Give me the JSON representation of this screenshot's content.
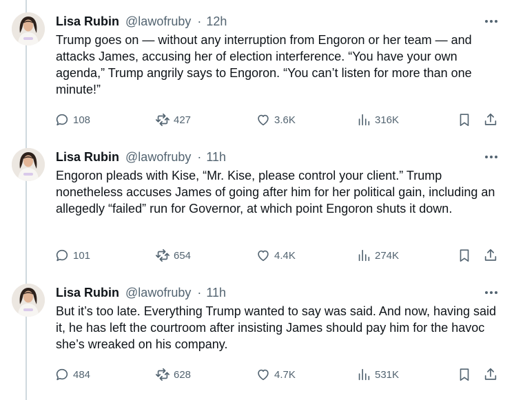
{
  "tweets": [
    {
      "author_name": "Lisa Rubin",
      "handle": "@lawofruby",
      "time": "12h",
      "text": "Trump goes on — without any interruption from Engoron or her team — and attacks James, accusing her of election interference. “You have your own agenda,” Trump angrily says to Engoron. “You can’t listen for more than one minute!”",
      "replies": "108",
      "reposts": "427",
      "likes": "3.6K",
      "views": "316K"
    },
    {
      "author_name": "Lisa Rubin",
      "handle": "@lawofruby",
      "time": "11h",
      "text": "Engoron pleads with Kise, “Mr. Kise, please control your client.” Trump nonetheless accuses James of going after him for her political gain, including an allegedly “failed” run for Governor, at which point Engoron shuts it down.",
      "replies": "101",
      "reposts": "654",
      "likes": "4.4K",
      "views": "274K"
    },
    {
      "author_name": "Lisa Rubin",
      "handle": "@lawofruby",
      "time": "11h",
      "text": "But it’s too late. Everything Trump wanted to say was said. And now, having said it, he has left the courtroom after insisting James should pay him for the havoc she’s wreaked on his company.",
      "replies": "484",
      "reposts": "628",
      "likes": "4.7K",
      "views": "531K"
    }
  ],
  "separator": "·",
  "icons": {
    "reply": "reply-icon",
    "repost": "repost-icon",
    "like": "like-icon",
    "views": "views-icon",
    "bookmark": "bookmark-icon",
    "share": "share-icon",
    "more": "more-icon"
  },
  "colors": {
    "text_primary": "#0f1419",
    "text_secondary": "#536471",
    "thread_line": "#cfd9de",
    "background": "#ffffff"
  }
}
